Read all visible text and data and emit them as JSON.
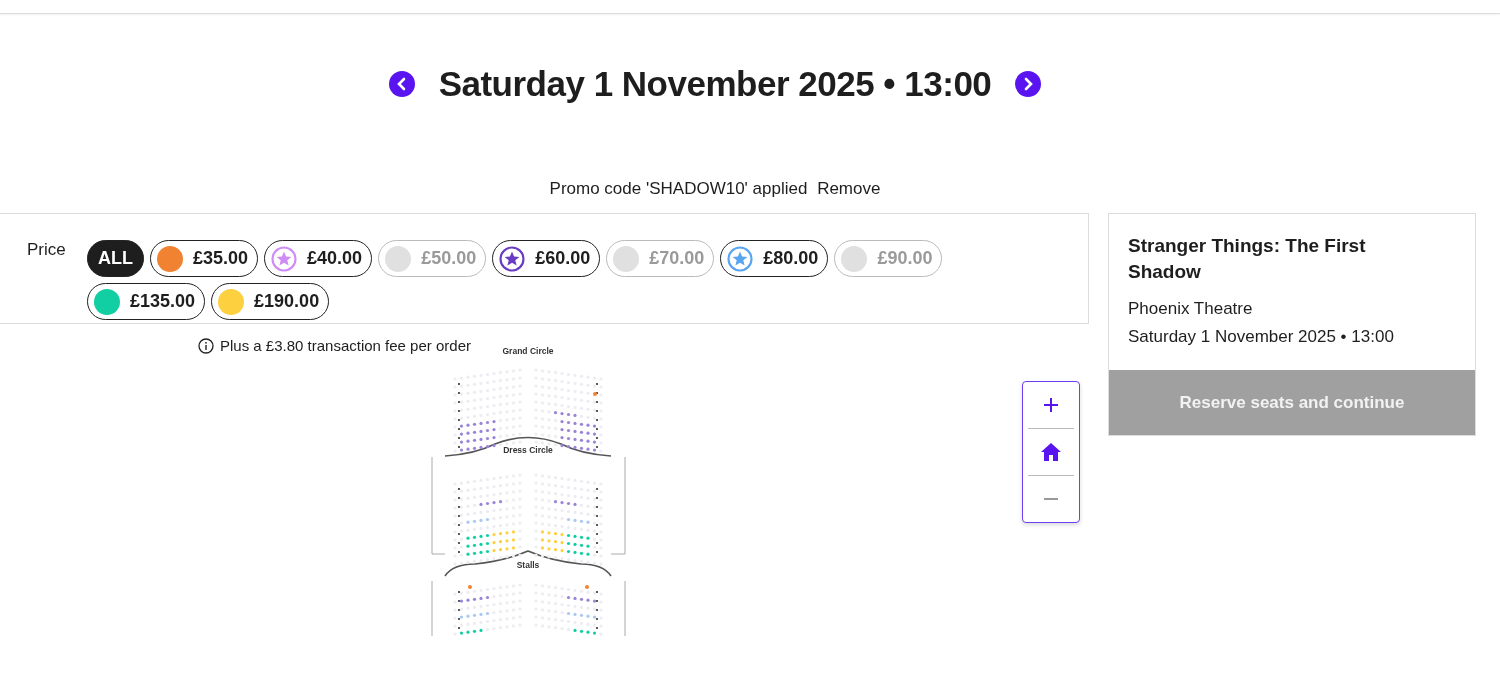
{
  "date_nav": {
    "title": "Saturday 1 November 2025 • 13:00",
    "prev_disabled": false,
    "next_disabled": false
  },
  "promo": {
    "text": "Promo code 'SHADOW10' applied",
    "action": "Remove"
  },
  "price_filter": {
    "label": "Price",
    "options": [
      {
        "label": "ALL",
        "kind": "all",
        "selected": true,
        "disabled": false
      },
      {
        "label": "£35.00",
        "kind": "dot",
        "color": "#f08232",
        "selected": false,
        "disabled": false
      },
      {
        "label": "£40.00",
        "kind": "star",
        "color": "#d08cf5",
        "selected": false,
        "disabled": false
      },
      {
        "label": "£50.00",
        "kind": "dot",
        "color": "#e0e0e0",
        "selected": false,
        "disabled": true
      },
      {
        "label": "£60.00",
        "kind": "star",
        "color": "#6a3cc4",
        "selected": false,
        "disabled": false
      },
      {
        "label": "£70.00",
        "kind": "dot",
        "color": "#e0e0e0",
        "selected": false,
        "disabled": true
      },
      {
        "label": "£80.00",
        "kind": "star",
        "color": "#5aa5f0",
        "selected": false,
        "disabled": false
      },
      {
        "label": "£90.00",
        "kind": "dot",
        "color": "#e0e0e0",
        "selected": false,
        "disabled": true
      },
      {
        "label": "£135.00",
        "kind": "dot",
        "color": "#12cfa3",
        "selected": false,
        "disabled": false
      },
      {
        "label": "£190.00",
        "kind": "dot",
        "color": "#fcd03f",
        "selected": false,
        "disabled": false
      }
    ]
  },
  "fee_note": "Plus a £3.80 transaction fee per order",
  "seat_map": {
    "sections": [
      "Grand Circle",
      "Dress Circle",
      "Stalls"
    ]
  },
  "zoom_controls": [
    {
      "kind": "zoom_in",
      "disabled": false
    },
    {
      "kind": "reset",
      "disabled": false
    },
    {
      "kind": "zoom_out",
      "disabled": true
    }
  ],
  "summary": {
    "show": "Stranger Things: The First Shadow",
    "venue": "Phoenix Theatre",
    "datetime": "Saturday 1 November 2025 • 13:00",
    "button": {
      "label": "Reserve seats and continue",
      "disabled": true
    }
  }
}
